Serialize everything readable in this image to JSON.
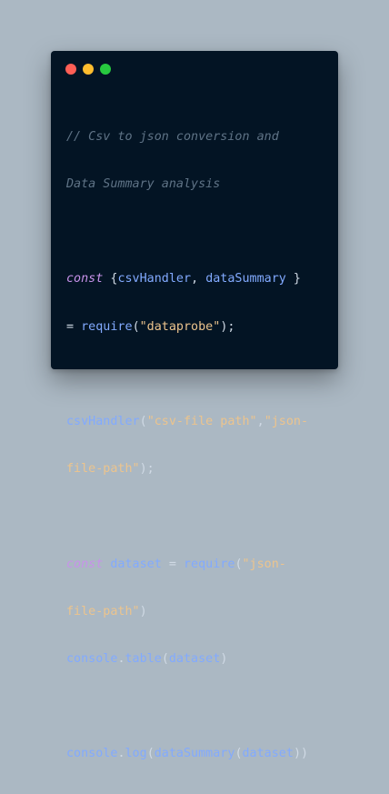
{
  "window": {
    "controls": {
      "close_color": "#ff5f56",
      "minimize_color": "#ffbd2e",
      "maximize_color": "#27c93f"
    },
    "background_color": "#031424"
  },
  "code": {
    "comment_line1": "// Csv to json conversion and",
    "comment_line2": "Data Summary analysis",
    "l3_kw": "const",
    "l3_open": " {",
    "l3_a": "csvHandler",
    "l3_comma": ", ",
    "l3_b": "dataSummary",
    "l3_close": " }",
    "l4_eq": "= ",
    "l4_fn": "require",
    "l4_open": "(",
    "l4_str": "\"dataprobe\"",
    "l4_close": ");",
    "l6_fn": "csvHandler",
    "l6_open": "(",
    "l6_str1": "\"csv-file path\"",
    "l6_comma": ",",
    "l6_str2": "\"json-",
    "l7_str": "file-path\"",
    "l7_close": ");",
    "l9_kw": "const",
    "l9_var": " dataset",
    "l9_eq": " = ",
    "l9_fn": "require",
    "l9_open": "(",
    "l9_str": "\"json-",
    "l10_str": "file-path\"",
    "l10_close": ")",
    "l11_obj": "console",
    "l11_dot": ".",
    "l11_method": "table",
    "l11_open": "(",
    "l11_arg": "dataset",
    "l11_close": ")",
    "l13_obj": "console",
    "l13_dot": ".",
    "l13_method": "log",
    "l13_open": "(",
    "l13_fn": "dataSummary",
    "l13_open2": "(",
    "l13_arg": "dataset",
    "l13_close": "))"
  }
}
